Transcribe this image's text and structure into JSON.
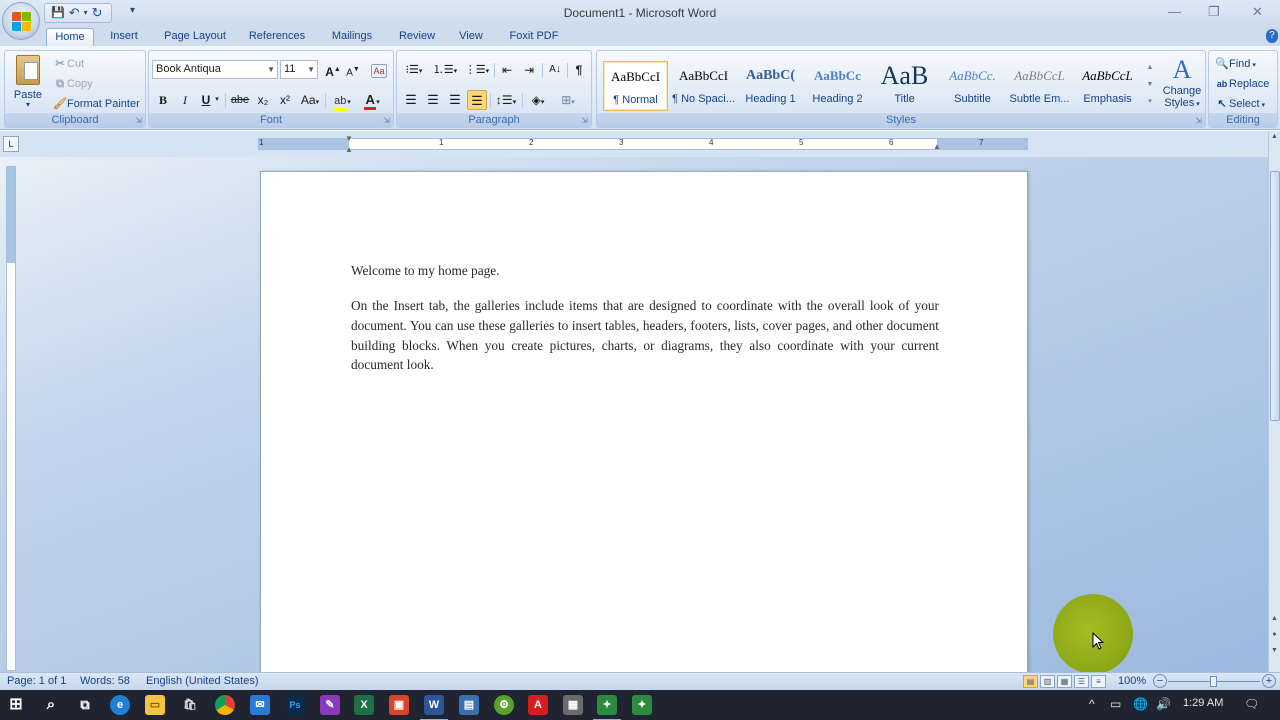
{
  "window": {
    "title": "Document1 - Microsoft Word",
    "minimize_icon": "—",
    "restore_icon": "❐",
    "close_icon": "✕"
  },
  "quick_access": {
    "save_icon": "💾",
    "undo_icon": "↶",
    "redo_icon": "↻",
    "customize_icon": "▾"
  },
  "tabs": [
    "Home",
    "Insert",
    "Page Layout",
    "References",
    "Mailings",
    "Review",
    "View",
    "Foxit PDF"
  ],
  "clipboard": {
    "label": "Clipboard",
    "paste": "Paste",
    "cut": "Cut",
    "copy": "Copy",
    "format_painter": "Format Painter"
  },
  "font": {
    "label": "Font",
    "family": "Book Antiqua",
    "size": "11",
    "bold": "B",
    "italic": "I",
    "underline": "U",
    "strikethrough": "abe",
    "subscript": "x₂",
    "superscript": "x²",
    "change_case": "Aa",
    "grow": "A",
    "shrink": "A"
  },
  "paragraph": {
    "label": "Paragraph",
    "pilcrow": "¶"
  },
  "styles": {
    "label": "Styles",
    "items": [
      {
        "sample": "AaBbCcI",
        "name": "¶ Normal"
      },
      {
        "sample": "AaBbCcI",
        "name": "¶ No Spaci..."
      },
      {
        "sample": "AaBbC(",
        "name": "Heading 1"
      },
      {
        "sample": "AaBbCc",
        "name": "Heading 2"
      },
      {
        "sample": "AaB",
        "name": "Title"
      },
      {
        "sample": "AaBbCc.",
        "name": "Subtitle"
      },
      {
        "sample": "AaBbCcL",
        "name": "Subtle Em..."
      },
      {
        "sample": "AaBbCcL",
        "name": "Emphasis"
      }
    ],
    "change_styles_line1": "Change",
    "change_styles_line2": "Styles"
  },
  "editing": {
    "label": "Editing",
    "find": "Find",
    "replace": "Replace",
    "select": "Select"
  },
  "ruler": {
    "numbers": [
      "1",
      "1",
      "2",
      "3",
      "4",
      "5",
      "6",
      "7"
    ]
  },
  "document": {
    "line1": "Welcome to  my home page.",
    "paragraph": "On the Insert tab, the galleries include items that are designed to coordinate with the overall look of your document. You can use these galleries to insert tables, headers, footers, lists, cover pages, and other document building blocks. When you create pictures, charts, or diagrams, they also coordinate with your current document look."
  },
  "status": {
    "page": "Page: 1 of 1",
    "words": "Words: 58",
    "language": "English (United States)",
    "zoom": "100%",
    "zoom_minus": "−",
    "zoom_plus": "+"
  },
  "taskbar": {
    "time": "1:29 AM"
  }
}
